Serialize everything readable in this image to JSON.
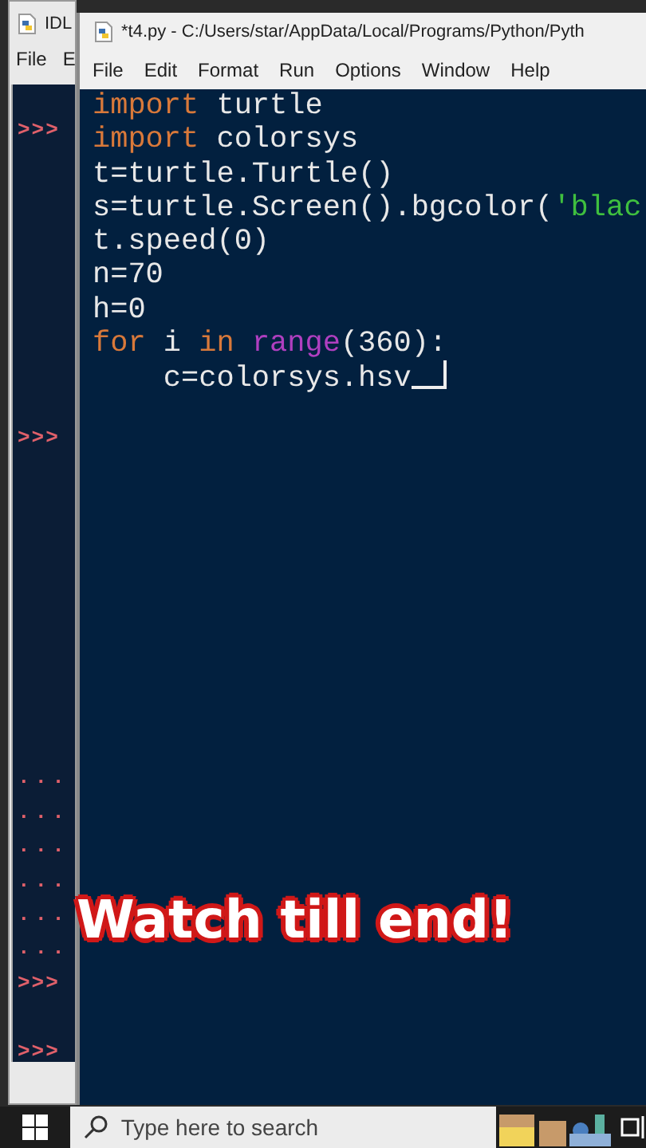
{
  "shell_window": {
    "title": "IDL",
    "menu": [
      "File",
      "E"
    ],
    "lines": [
      {
        "kind": "prompt",
        "text": ">>>"
      },
      {
        "kind": "hidden"
      },
      {
        "kind": "hidden"
      },
      {
        "kind": "hidden"
      },
      {
        "kind": "hidden"
      },
      {
        "kind": "hidden"
      },
      {
        "kind": "hidden"
      },
      {
        "kind": "hidden"
      },
      {
        "kind": "hidden"
      },
      {
        "kind": "prompt",
        "text": ">>>"
      },
      {
        "kind": "hidden"
      },
      {
        "kind": "hidden"
      },
      {
        "kind": "hidden"
      },
      {
        "kind": "hidden"
      },
      {
        "kind": "hidden"
      },
      {
        "kind": "hidden"
      },
      {
        "kind": "hidden"
      },
      {
        "kind": "hidden"
      },
      {
        "kind": "hidden"
      },
      {
        "kind": "continuation",
        "text": "..."
      },
      {
        "kind": "continuation",
        "text": "..."
      },
      {
        "kind": "continuation",
        "text": "..."
      },
      {
        "kind": "continuation",
        "text": "..."
      },
      {
        "kind": "continuation",
        "text": "..."
      },
      {
        "kind": "continuation",
        "text": "..."
      },
      {
        "kind": "prompt",
        "text": ">>>"
      },
      {
        "kind": "hidden"
      },
      {
        "kind": "prompt",
        "text": ">>>"
      }
    ]
  },
  "editor_window": {
    "title": "*t4.py - C:/Users/star/AppData/Local/Programs/Python/Pyth",
    "menu": [
      "File",
      "Edit",
      "Format",
      "Run",
      "Options",
      "Window",
      "Help"
    ],
    "code_lines": [
      [
        {
          "kind": "keyword",
          "text": "import"
        },
        {
          "kind": "plain",
          "text": " turtle"
        }
      ],
      [
        {
          "kind": "keyword",
          "text": "import"
        },
        {
          "kind": "plain",
          "text": " colorsys"
        }
      ],
      [
        {
          "kind": "plain",
          "text": "t=turtle.Turtle()"
        }
      ],
      [
        {
          "kind": "plain",
          "text": "s=turtle.Screen().bgcolor("
        },
        {
          "kind": "string",
          "text": "'blac"
        }
      ],
      [
        {
          "kind": "plain",
          "text": "t.speed(0)"
        }
      ],
      [
        {
          "kind": "plain",
          "text": "n=70"
        }
      ],
      [
        {
          "kind": "plain",
          "text": "h=0"
        }
      ],
      [
        {
          "kind": "keyword",
          "text": "for"
        },
        {
          "kind": "plain",
          "text": " i "
        },
        {
          "kind": "keyword",
          "text": "in "
        },
        {
          "kind": "builtin",
          "text": "range"
        },
        {
          "kind": "plain",
          "text": "(360):"
        }
      ],
      [
        {
          "kind": "plain",
          "text": "    c=colorsys.hsv"
        },
        {
          "kind": "cursor"
        }
      ]
    ]
  },
  "caption": "Watch till end!",
  "taskbar": {
    "search": {
      "placeholder": "Type here to search"
    }
  }
}
